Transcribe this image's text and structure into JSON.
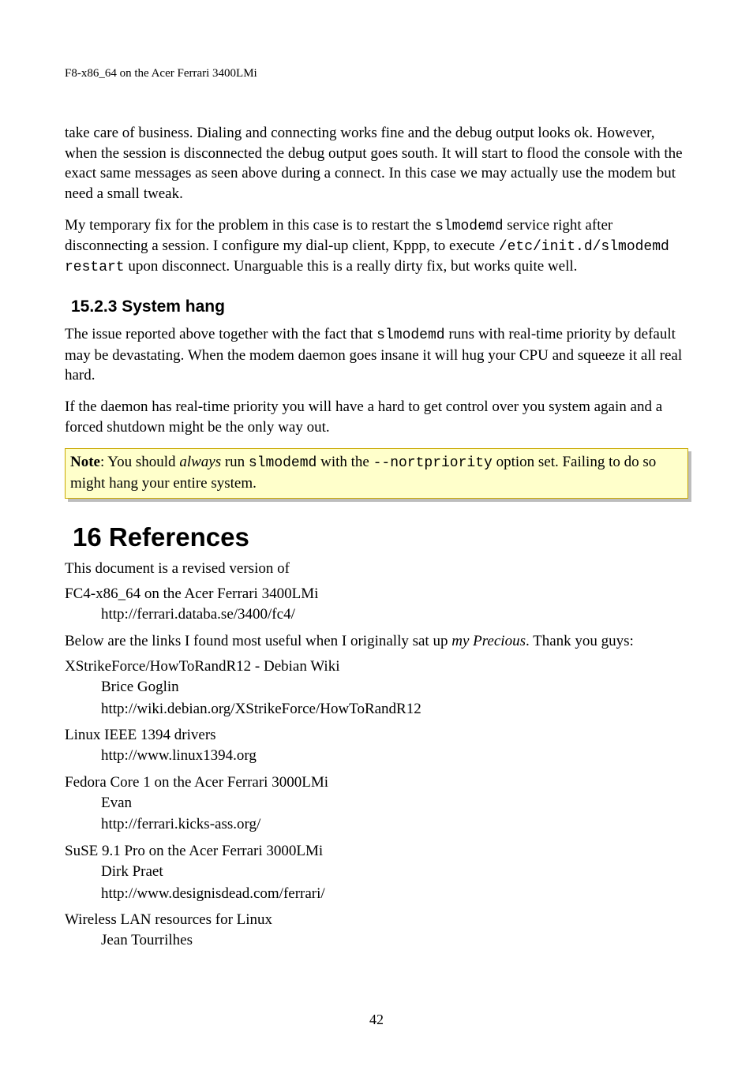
{
  "header": {
    "running_title": "F8-x86_64 on the Acer Ferrari 3400LMi"
  },
  "paragraphs": {
    "p1_a": "take care of business. Dialing and connecting works fine and the debug output looks ok. However, when the session is disconnected the debug output goes south. It will start to flood the console with the exact same messages as seen above during a connect. In this case we may actually use the modem but need a small tweak.",
    "p2_a": "My temporary fix for the problem in this case is to restart the ",
    "p2_code1": "slmodemd",
    "p2_b": " service right after disconnecting a session. I configure my dial-up client, Kppp, to execute ",
    "p2_code2": "/etc/init.d/slmodemd restart",
    "p2_c": " upon disconnect. Unarguable this is a really dirty fix, but works quite well.",
    "p3_a": "The issue reported above together with the fact that ",
    "p3_code1": "slmodemd",
    "p3_b": " runs with real-time priority by default may be devastating. When the modem daemon goes insane it will hug your CPU and squeeze it all real hard.",
    "p4_a": "If the daemon has real-time priority you will have a hard to get control over you system again and a forced shutdown might be the only way out."
  },
  "subsection": {
    "num_title": "15.2.3 System hang"
  },
  "note": {
    "label": "Note",
    "a": ": You should ",
    "italic": "always",
    "b": " run ",
    "code1": "slmodemd",
    "c": " with the ",
    "code2": "--nortpriority",
    "d": " option set. Failing to do so might hang your entire system."
  },
  "section": {
    "num_title": "16 References"
  },
  "ref_intro": {
    "a": "This document is a revised version of",
    "title": "FC4-x86_64 on the Acer Ferrari 3400LMi",
    "url": "http://ferrari.databa.se/3400/fc4/",
    "b_a": "Below are the links I found most useful when I originally sat up ",
    "b_italic": "my Precious",
    "b_c": ". Thank you guys:"
  },
  "refs": [
    {
      "title": "XStrikeForce/HowToRandR12 - Debian Wiki",
      "author": "Brice Goglin",
      "url": "http://wiki.debian.org/XStrikeForce/HowToRandR12"
    },
    {
      "title": "Linux IEEE 1394 drivers",
      "author": "",
      "url": "http://www.linux1394.org"
    },
    {
      "title": "Fedora Core 1 on the Acer Ferrari 3000LMi",
      "author": "Evan",
      "url": "http://ferrari.kicks-ass.org/"
    },
    {
      "title": "SuSE 9.1 Pro on the Acer Ferrari 3000LMi",
      "author": "Dirk Praet",
      "url": "http://www.designisdead.com/ferrari/"
    },
    {
      "title": "Wireless LAN resources for Linux",
      "author": "Jean Tourrilhes",
      "url": ""
    }
  ],
  "page_number": "42"
}
